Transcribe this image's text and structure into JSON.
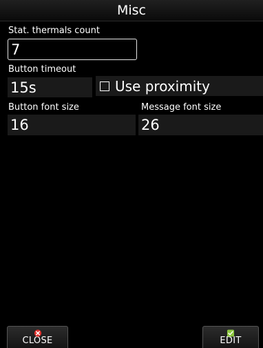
{
  "window": {
    "title": "Misc"
  },
  "fields": {
    "stat_thermals_count": {
      "label": "Stat. thermals count",
      "value": "7"
    },
    "button_timeout": {
      "label": "Button timeout",
      "value": "15s"
    },
    "use_proximity": {
      "label": "Use proximity",
      "checked": false
    },
    "button_font_size": {
      "label": "Button font size",
      "value": "16"
    },
    "message_font_size": {
      "label": "Message font size",
      "value": "26"
    }
  },
  "buttons": {
    "close": {
      "label": "CLOSE",
      "icon": "close-icon",
      "icon_color": "#e0322d"
    },
    "edit": {
      "label": "EDIT",
      "icon": "check-icon",
      "icon_color": "#8cc63f"
    }
  }
}
